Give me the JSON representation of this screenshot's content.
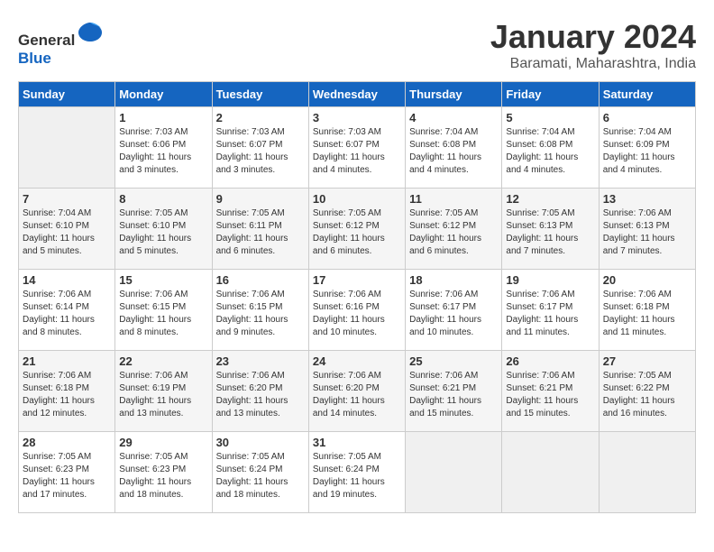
{
  "header": {
    "logo_general": "General",
    "logo_blue": "Blue",
    "title": "January 2024",
    "subtitle": "Baramati, Maharashtra, India"
  },
  "columns": [
    "Sunday",
    "Monday",
    "Tuesday",
    "Wednesday",
    "Thursday",
    "Friday",
    "Saturday"
  ],
  "weeks": [
    [
      {
        "day": "",
        "sunrise": "",
        "sunset": "",
        "daylight": "",
        "empty": true
      },
      {
        "day": "1",
        "sunrise": "Sunrise: 7:03 AM",
        "sunset": "Sunset: 6:06 PM",
        "daylight": "Daylight: 11 hours and 3 minutes."
      },
      {
        "day": "2",
        "sunrise": "Sunrise: 7:03 AM",
        "sunset": "Sunset: 6:07 PM",
        "daylight": "Daylight: 11 hours and 3 minutes."
      },
      {
        "day": "3",
        "sunrise": "Sunrise: 7:03 AM",
        "sunset": "Sunset: 6:07 PM",
        "daylight": "Daylight: 11 hours and 4 minutes."
      },
      {
        "day": "4",
        "sunrise": "Sunrise: 7:04 AM",
        "sunset": "Sunset: 6:08 PM",
        "daylight": "Daylight: 11 hours and 4 minutes."
      },
      {
        "day": "5",
        "sunrise": "Sunrise: 7:04 AM",
        "sunset": "Sunset: 6:08 PM",
        "daylight": "Daylight: 11 hours and 4 minutes."
      },
      {
        "day": "6",
        "sunrise": "Sunrise: 7:04 AM",
        "sunset": "Sunset: 6:09 PM",
        "daylight": "Daylight: 11 hours and 4 minutes."
      }
    ],
    [
      {
        "day": "7",
        "sunrise": "Sunrise: 7:04 AM",
        "sunset": "Sunset: 6:10 PM",
        "daylight": "Daylight: 11 hours and 5 minutes."
      },
      {
        "day": "8",
        "sunrise": "Sunrise: 7:05 AM",
        "sunset": "Sunset: 6:10 PM",
        "daylight": "Daylight: 11 hours and 5 minutes."
      },
      {
        "day": "9",
        "sunrise": "Sunrise: 7:05 AM",
        "sunset": "Sunset: 6:11 PM",
        "daylight": "Daylight: 11 hours and 6 minutes."
      },
      {
        "day": "10",
        "sunrise": "Sunrise: 7:05 AM",
        "sunset": "Sunset: 6:12 PM",
        "daylight": "Daylight: 11 hours and 6 minutes."
      },
      {
        "day": "11",
        "sunrise": "Sunrise: 7:05 AM",
        "sunset": "Sunset: 6:12 PM",
        "daylight": "Daylight: 11 hours and 6 minutes."
      },
      {
        "day": "12",
        "sunrise": "Sunrise: 7:05 AM",
        "sunset": "Sunset: 6:13 PM",
        "daylight": "Daylight: 11 hours and 7 minutes."
      },
      {
        "day": "13",
        "sunrise": "Sunrise: 7:06 AM",
        "sunset": "Sunset: 6:13 PM",
        "daylight": "Daylight: 11 hours and 7 minutes."
      }
    ],
    [
      {
        "day": "14",
        "sunrise": "Sunrise: 7:06 AM",
        "sunset": "Sunset: 6:14 PM",
        "daylight": "Daylight: 11 hours and 8 minutes."
      },
      {
        "day": "15",
        "sunrise": "Sunrise: 7:06 AM",
        "sunset": "Sunset: 6:15 PM",
        "daylight": "Daylight: 11 hours and 8 minutes."
      },
      {
        "day": "16",
        "sunrise": "Sunrise: 7:06 AM",
        "sunset": "Sunset: 6:15 PM",
        "daylight": "Daylight: 11 hours and 9 minutes."
      },
      {
        "day": "17",
        "sunrise": "Sunrise: 7:06 AM",
        "sunset": "Sunset: 6:16 PM",
        "daylight": "Daylight: 11 hours and 10 minutes."
      },
      {
        "day": "18",
        "sunrise": "Sunrise: 7:06 AM",
        "sunset": "Sunset: 6:17 PM",
        "daylight": "Daylight: 11 hours and 10 minutes."
      },
      {
        "day": "19",
        "sunrise": "Sunrise: 7:06 AM",
        "sunset": "Sunset: 6:17 PM",
        "daylight": "Daylight: 11 hours and 11 minutes."
      },
      {
        "day": "20",
        "sunrise": "Sunrise: 7:06 AM",
        "sunset": "Sunset: 6:18 PM",
        "daylight": "Daylight: 11 hours and 11 minutes."
      }
    ],
    [
      {
        "day": "21",
        "sunrise": "Sunrise: 7:06 AM",
        "sunset": "Sunset: 6:18 PM",
        "daylight": "Daylight: 11 hours and 12 minutes."
      },
      {
        "day": "22",
        "sunrise": "Sunrise: 7:06 AM",
        "sunset": "Sunset: 6:19 PM",
        "daylight": "Daylight: 11 hours and 13 minutes."
      },
      {
        "day": "23",
        "sunrise": "Sunrise: 7:06 AM",
        "sunset": "Sunset: 6:20 PM",
        "daylight": "Daylight: 11 hours and 13 minutes."
      },
      {
        "day": "24",
        "sunrise": "Sunrise: 7:06 AM",
        "sunset": "Sunset: 6:20 PM",
        "daylight": "Daylight: 11 hours and 14 minutes."
      },
      {
        "day": "25",
        "sunrise": "Sunrise: 7:06 AM",
        "sunset": "Sunset: 6:21 PM",
        "daylight": "Daylight: 11 hours and 15 minutes."
      },
      {
        "day": "26",
        "sunrise": "Sunrise: 7:06 AM",
        "sunset": "Sunset: 6:21 PM",
        "daylight": "Daylight: 11 hours and 15 minutes."
      },
      {
        "day": "27",
        "sunrise": "Sunrise: 7:05 AM",
        "sunset": "Sunset: 6:22 PM",
        "daylight": "Daylight: 11 hours and 16 minutes."
      }
    ],
    [
      {
        "day": "28",
        "sunrise": "Sunrise: 7:05 AM",
        "sunset": "Sunset: 6:23 PM",
        "daylight": "Daylight: 11 hours and 17 minutes."
      },
      {
        "day": "29",
        "sunrise": "Sunrise: 7:05 AM",
        "sunset": "Sunset: 6:23 PM",
        "daylight": "Daylight: 11 hours and 18 minutes."
      },
      {
        "day": "30",
        "sunrise": "Sunrise: 7:05 AM",
        "sunset": "Sunset: 6:24 PM",
        "daylight": "Daylight: 11 hours and 18 minutes."
      },
      {
        "day": "31",
        "sunrise": "Sunrise: 7:05 AM",
        "sunset": "Sunset: 6:24 PM",
        "daylight": "Daylight: 11 hours and 19 minutes."
      },
      {
        "day": "",
        "sunrise": "",
        "sunset": "",
        "daylight": "",
        "empty": true
      },
      {
        "day": "",
        "sunrise": "",
        "sunset": "",
        "daylight": "",
        "empty": true
      },
      {
        "day": "",
        "sunrise": "",
        "sunset": "",
        "daylight": "",
        "empty": true
      }
    ]
  ]
}
